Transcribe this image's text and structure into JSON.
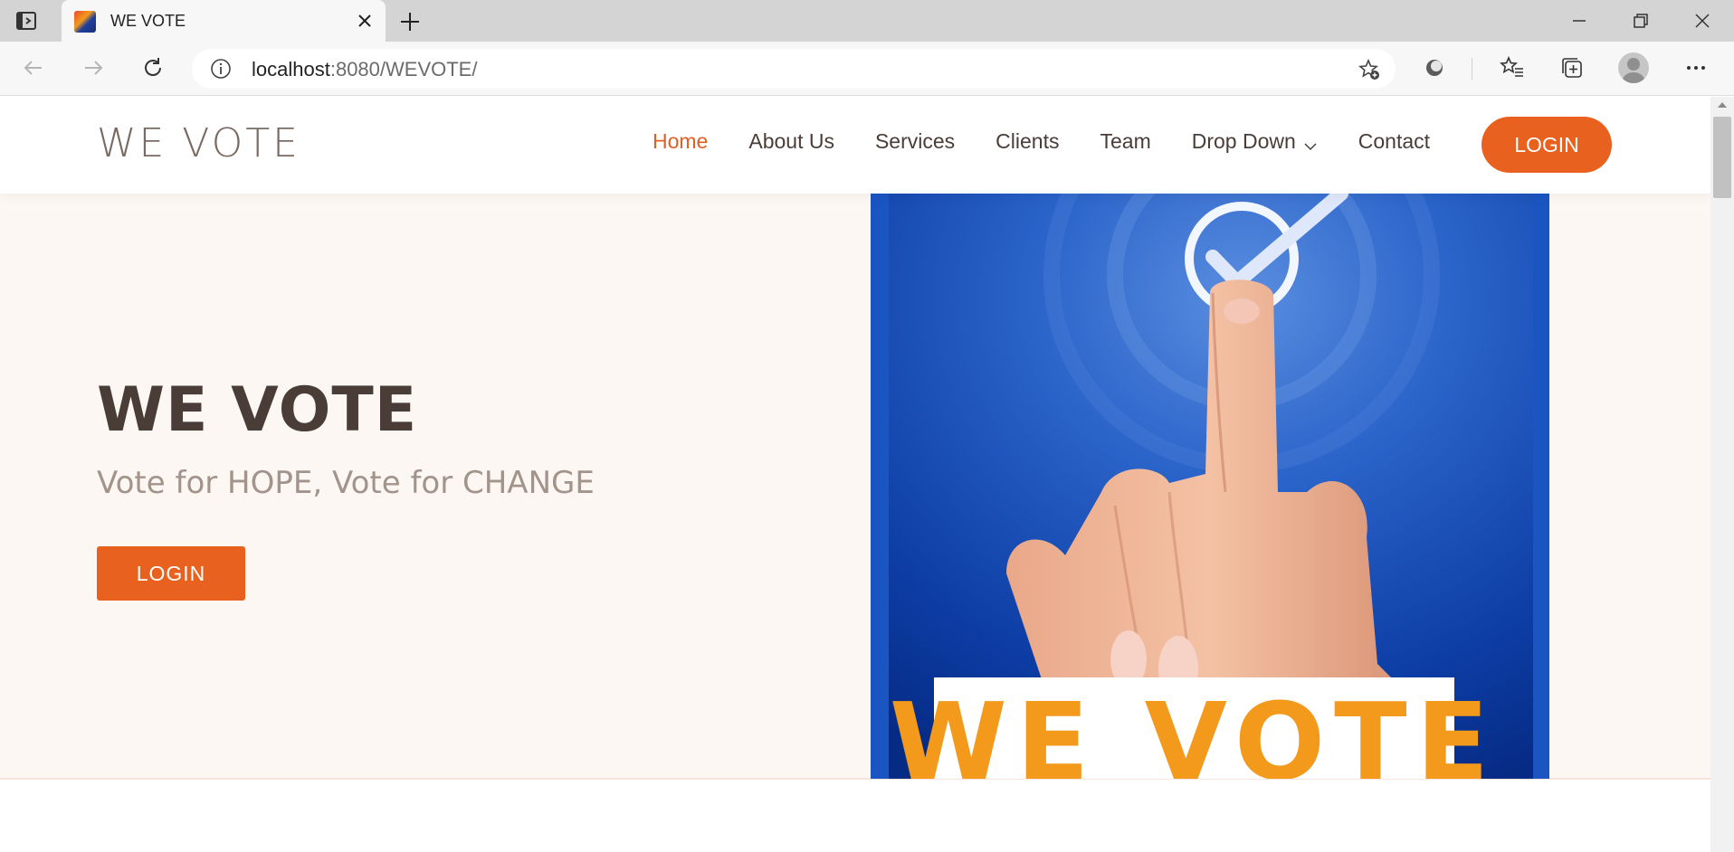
{
  "browser": {
    "tab_title": "WE VOTE",
    "url_host": "localhost",
    "url_rest": ":8080/WEVOTE/"
  },
  "site": {
    "logo": "WE VOTE",
    "nav": [
      {
        "label": "Home",
        "active": true
      },
      {
        "label": "About Us"
      },
      {
        "label": "Services"
      },
      {
        "label": "Clients"
      },
      {
        "label": "Team"
      },
      {
        "label": "Drop Down",
        "has_dropdown": true
      },
      {
        "label": "Contact"
      }
    ],
    "nav_login": "LOGIN"
  },
  "hero": {
    "title": "WE VOTE",
    "subtitle": "Vote for HOPE, Vote for CHANGE",
    "login_label": "LOGIN",
    "image_text": "WE VOTE"
  },
  "colors": {
    "accent": "#e8611f",
    "nav_active": "#e25e24",
    "hero_bg": "#fcf7f3",
    "heading": "#4a3d37",
    "image_banner_text": "#f39a1c"
  },
  "icons": {
    "tab_actions": "tab-actions-icon",
    "close": "close-icon",
    "new_tab": "plus-icon",
    "back": "back-arrow-icon",
    "forward": "forward-arrow-icon",
    "refresh": "refresh-icon",
    "info": "info-icon",
    "add_favorite": "star-add-icon",
    "extension": "extension-icon",
    "favorites": "favorites-icon",
    "collections": "collections-icon",
    "profile": "avatar-icon",
    "more": "more-icon"
  }
}
